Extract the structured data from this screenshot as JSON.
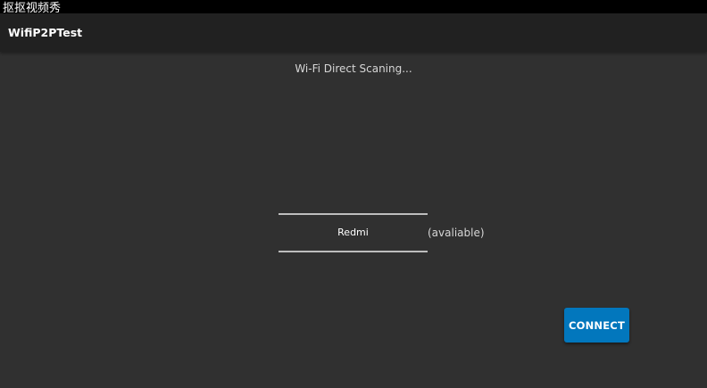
{
  "watermark": {
    "text": "抠抠视频秀"
  },
  "appbar": {
    "title": "WifiP2PTest"
  },
  "scan": {
    "status_text": "Wi-Fi Direct Scaning..."
  },
  "devices": [
    {
      "name": "Redmi",
      "status": "(avaliable)"
    }
  ],
  "actions": {
    "connect_label": "CONNECT"
  },
  "colors": {
    "background": "#303030",
    "appbar": "#212121",
    "accent": "#0277bd",
    "divider": "#bdbdbd"
  }
}
